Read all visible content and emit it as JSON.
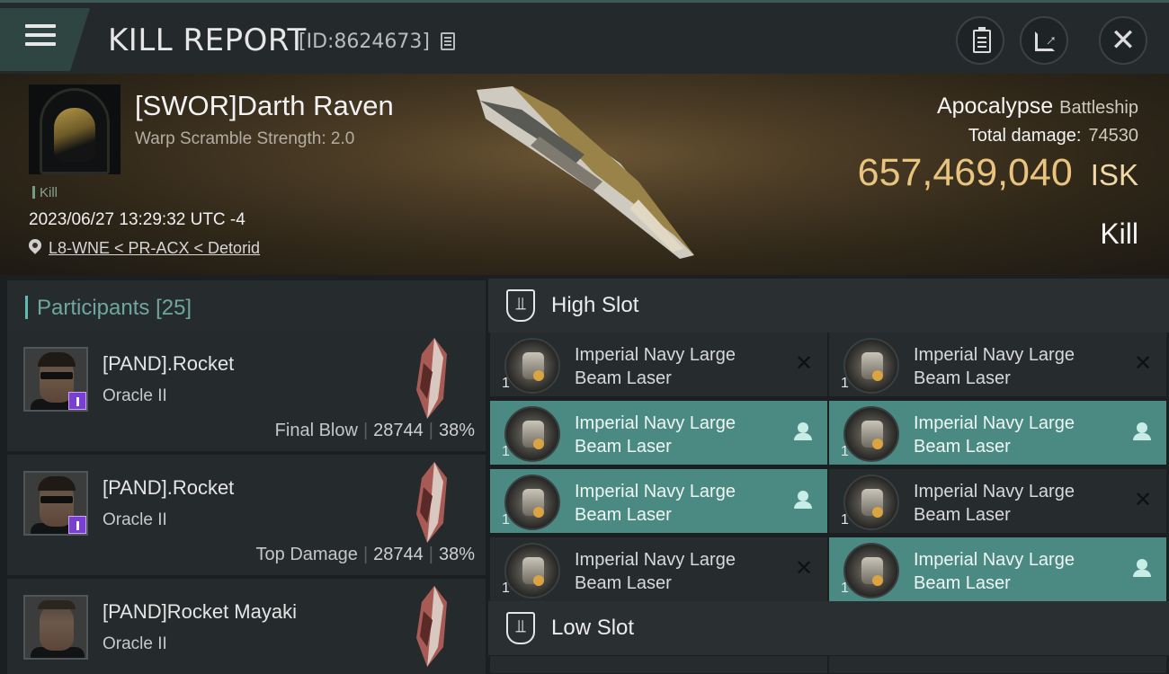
{
  "header": {
    "title": "KILL REPORT",
    "id_text": "[ID:8624673]",
    "buttons": [
      "clipboard",
      "share",
      "close"
    ]
  },
  "victim": {
    "name": "[SWOR]Darth Raven",
    "subtitle": "Warp Scramble Strength: 2.0",
    "tag": "Kill",
    "datetime": "2023/06/27 13:29:32 UTC -4",
    "location": "L8-WNE < PR-ACX < Detorid",
    "ship": "Apocalypse",
    "ship_class": "Battleship",
    "total_damage_label": "Total damage:",
    "total_damage": "74530",
    "isk_value": "657,469,040",
    "isk_unit": "ISK",
    "result": "Kill"
  },
  "participants": {
    "label": "Participants",
    "count": "[25]",
    "rows": [
      {
        "name": "[PAND].Rocket",
        "ship": "Oracle II",
        "stat_label": "Final Blow",
        "damage": "28744",
        "percent": "38%"
      },
      {
        "name": "[PAND].Rocket",
        "ship": "Oracle II",
        "stat_label": "Top Damage",
        "damage": "28744",
        "percent": "38%"
      },
      {
        "name": "[PAND]Rocket Mayaki",
        "ship": "Oracle II"
      }
    ]
  },
  "slots": {
    "high_title": "High Slot",
    "low_title": "Low Slot",
    "high_items": [
      {
        "name": "Imperial Navy Large Beam Laser",
        "qty": "1",
        "status": "destroyed"
      },
      {
        "name": "Imperial Navy Large Beam Laser",
        "qty": "1",
        "status": "destroyed"
      },
      {
        "name": "Imperial Navy Large Beam Laser",
        "qty": "1",
        "status": "dropped"
      },
      {
        "name": "Imperial Navy Large Beam Laser",
        "qty": "1",
        "status": "dropped"
      },
      {
        "name": "Imperial Navy Large Beam Laser",
        "qty": "1",
        "status": "dropped"
      },
      {
        "name": "Imperial Navy Large Beam Laser",
        "qty": "1",
        "status": "destroyed"
      },
      {
        "name": "Imperial Navy Large Beam Laser",
        "qty": "1",
        "status": "destroyed"
      },
      {
        "name": "Imperial Navy Large Beam Laser",
        "qty": "1",
        "status": "dropped"
      }
    ]
  },
  "colors": {
    "accent": "#5fbcb1",
    "isk": "#e8c47f",
    "dropped_row": "#4b8a82",
    "badge": "#7b3ed2"
  }
}
